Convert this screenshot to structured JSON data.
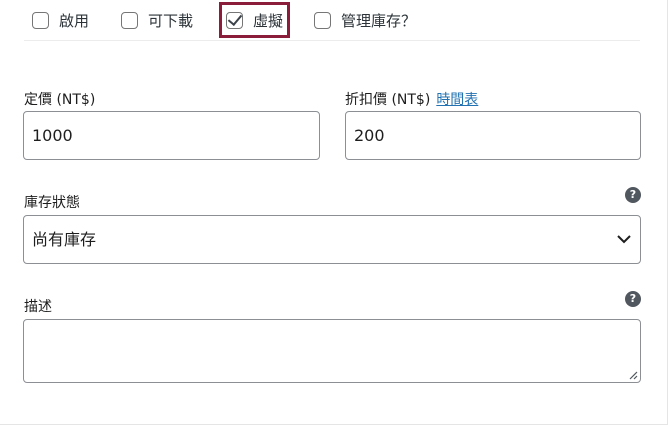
{
  "options": [
    {
      "label": "啟用",
      "checked": false
    },
    {
      "label": "可下載",
      "checked": false
    },
    {
      "label": "虛擬",
      "checked": true
    },
    {
      "label": "管理庫存？",
      "checked": false
    }
  ],
  "regular_price": {
    "label": "定價 (NT$)",
    "value": "1000"
  },
  "sale_price": {
    "label": "折扣價 (NT$)",
    "schedule_link": "時間表",
    "value": "200"
  },
  "stock_status": {
    "label": "庫存狀態",
    "value": "尚有庫存"
  },
  "description": {
    "label": "描述",
    "value": ""
  },
  "icons": {
    "help": "help-icon",
    "dropdown": "chevron-down-icon",
    "check": "checkmark-icon"
  },
  "colors": {
    "highlight": "#8b1d3b",
    "link": "#2271b1",
    "help_icon": "#50575e",
    "border": "#8c8f94"
  }
}
